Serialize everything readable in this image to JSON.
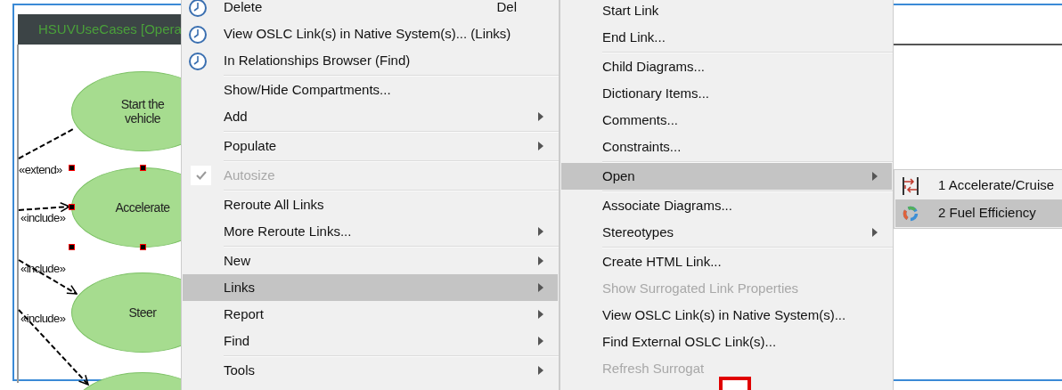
{
  "diagram": {
    "tab_title": "HSUVUseCases [Opera",
    "use_cases": [
      {
        "label": "Start the vehicle",
        "selected": false
      },
      {
        "label": "Accelerate",
        "selected": true
      },
      {
        "label": "Steer",
        "selected": false
      },
      {
        "selected": false
      }
    ],
    "relationships": [
      {
        "label": "«extend»"
      },
      {
        "label": "«include»"
      },
      {
        "label": "«include»"
      },
      {
        "label": "«include»"
      }
    ]
  },
  "context_menu": {
    "items": [
      {
        "kind": "with-icon",
        "label": "Delete",
        "shortcut": "Del",
        "selected": false,
        "disabled": false
      },
      {
        "kind": "with-icon",
        "label": "View OSLC Link(s) in Native System(s)... (Links)",
        "selected": false,
        "disabled": false
      },
      {
        "kind": "with-icon",
        "label": "In Relationships Browser (Find)",
        "selected": false,
        "disabled": false
      },
      {
        "kind": "separator"
      },
      {
        "kind": "plain",
        "label": "Show/Hide Compartments...",
        "selected": false,
        "disabled": false
      },
      {
        "kind": "plain",
        "label": "Add",
        "submenu": true,
        "selected": false,
        "disabled": false
      },
      {
        "kind": "separator"
      },
      {
        "kind": "plain",
        "label": "Populate",
        "submenu": true,
        "selected": false,
        "disabled": false
      },
      {
        "kind": "separator"
      },
      {
        "kind": "plain",
        "label": "Autosize",
        "checked": true,
        "selected": false,
        "disabled": true
      },
      {
        "kind": "separator"
      },
      {
        "kind": "plain",
        "label": "Reroute All Links",
        "selected": false,
        "disabled": false
      },
      {
        "kind": "plain",
        "label": "More Reroute Links...",
        "submenu": true,
        "selected": false,
        "disabled": false
      },
      {
        "kind": "separator"
      },
      {
        "kind": "plain",
        "label": "New",
        "submenu": true,
        "selected": false,
        "disabled": false
      },
      {
        "kind": "plain",
        "label": "Links",
        "submenu": true,
        "selected": true,
        "disabled": false
      },
      {
        "kind": "plain",
        "label": "Report",
        "submenu": true,
        "selected": false,
        "disabled": false
      },
      {
        "kind": "plain",
        "label": "Find",
        "submenu": true,
        "selected": false,
        "disabled": false
      },
      {
        "kind": "separator"
      },
      {
        "kind": "plain",
        "label": "Tools",
        "submenu": true,
        "selected": false,
        "disabled": false
      }
    ]
  },
  "links_submenu": {
    "items": [
      {
        "kind": "plain",
        "label": "Start Link",
        "selected": false,
        "disabled": false
      },
      {
        "kind": "plain",
        "label": "End Link...",
        "selected": false,
        "disabled": false
      },
      {
        "kind": "separator"
      },
      {
        "kind": "plain",
        "label": "Child Diagrams...",
        "selected": false,
        "disabled": false
      },
      {
        "kind": "plain",
        "label": "Dictionary Items...",
        "selected": false,
        "disabled": false
      },
      {
        "kind": "plain",
        "label": "Comments...",
        "selected": false,
        "disabled": false
      },
      {
        "kind": "plain",
        "label": "Constraints...",
        "selected": false,
        "disabled": false
      },
      {
        "kind": "separator"
      },
      {
        "kind": "plain",
        "label": "Open",
        "submenu": true,
        "selected": true,
        "disabled": false
      },
      {
        "kind": "separator"
      },
      {
        "kind": "plain",
        "label": "Associate Diagrams...",
        "selected": false,
        "disabled": false
      },
      {
        "kind": "plain",
        "label": "Stereotypes",
        "submenu": true,
        "selected": false,
        "disabled": false
      },
      {
        "kind": "separator"
      },
      {
        "kind": "plain",
        "label": "Create HTML Link...",
        "selected": false,
        "disabled": false
      },
      {
        "kind": "plain",
        "label": "Show Surrogated Link Properties",
        "selected": false,
        "disabled": true
      },
      {
        "kind": "plain",
        "label": "View OSLC Link(s) in Native System(s)...",
        "selected": false,
        "disabled": false
      },
      {
        "kind": "plain",
        "label": "Find External OSLC Link(s)...",
        "selected": false,
        "disabled": false
      },
      {
        "kind": "plain",
        "label": "Refresh Surrogat",
        "selected": false,
        "disabled": true
      }
    ]
  },
  "open_submenu": {
    "items": [
      {
        "kind": "sequence-diagram",
        "label": "1 Accelerate/Cruise",
        "selected": false
      },
      {
        "kind": "parametric-diagram",
        "label": "2 Fuel Efficiency",
        "selected": true
      }
    ]
  }
}
